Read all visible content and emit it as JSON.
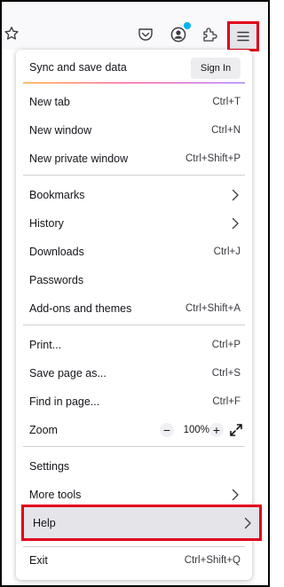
{
  "menu": {
    "sync": {
      "title": "Sync and save data",
      "signin": "Sign In"
    },
    "new_tab": {
      "label": "New tab",
      "shortcut": "Ctrl+T"
    },
    "new_window": {
      "label": "New window",
      "shortcut": "Ctrl+N"
    },
    "new_private_window": {
      "label": "New private window",
      "shortcut": "Ctrl+Shift+P"
    },
    "bookmarks": {
      "label": "Bookmarks"
    },
    "history": {
      "label": "History"
    },
    "downloads": {
      "label": "Downloads",
      "shortcut": "Ctrl+J"
    },
    "passwords": {
      "label": "Passwords"
    },
    "addons": {
      "label": "Add-ons and themes",
      "shortcut": "Ctrl+Shift+A"
    },
    "print": {
      "label": "Print...",
      "shortcut": "Ctrl+P"
    },
    "save_page": {
      "label": "Save page as...",
      "shortcut": "Ctrl+S"
    },
    "find": {
      "label": "Find in page...",
      "shortcut": "Ctrl+F"
    },
    "zoom": {
      "label": "Zoom",
      "minus": "−",
      "value": "100%",
      "plus": "+"
    },
    "settings": {
      "label": "Settings"
    },
    "more_tools": {
      "label": "More tools"
    },
    "help": {
      "label": "Help"
    },
    "exit": {
      "label": "Exit",
      "shortcut": "Ctrl+Shift+Q"
    }
  },
  "colors": {
    "highlight_border": "#e0001b",
    "account_dot": "#00b3f4",
    "hover_bg": "#e4e4e9"
  },
  "icons": [
    "star-icon",
    "pocket-icon",
    "account-icon",
    "extensions-icon",
    "hamburger-menu-icon",
    "chevron-right-icon",
    "fullscreen-icon"
  ]
}
